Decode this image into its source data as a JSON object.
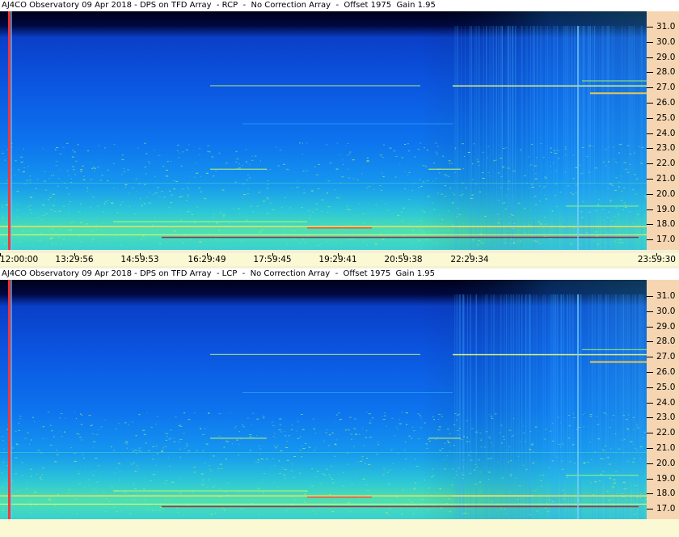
{
  "panels": [
    {
      "title": "AJ4CO Observatory 09 Apr 2018 - DPS on TFD Array  - RCP  -  No Correction Array  -  Offset 1975  Gain 1.95",
      "polarization": "RCP",
      "freq_labels": [
        "31.0",
        "30.0",
        "29.0",
        "28.0",
        "27.0",
        "26.0",
        "25.0",
        "24.0",
        "23.0",
        "22.0",
        "21.0",
        "20.0",
        "19.0",
        "18.0",
        "17.0"
      ],
      "time_labels": [
        "12:00:00",
        "13:29:56",
        "14:59:53",
        "16:29:49",
        "17:59:45",
        "19:29:41",
        "20:59:38",
        "22:29:34",
        "23:59:30"
      ]
    },
    {
      "title": "AJ4CO Observatory 09 Apr 2018 - DPS on TFD Array  - LCP  -  No Correction Array  -  Offset 1975  Gain 1.95",
      "polarization": "LCP",
      "freq_labels": [
        "31.0",
        "30.0",
        "29.0",
        "28.0",
        "27.0",
        "26.0",
        "25.0",
        "24.0",
        "23.0",
        "22.0",
        "21.0",
        "20.0",
        "19.0",
        "18.0",
        "17.0"
      ],
      "time_labels": []
    }
  ],
  "colors": {
    "background_top": "#00003a",
    "background_mid": "#0a4fd6",
    "background_low": "#2fd0c8",
    "freq_axis_bg": "#f6d6b2",
    "time_axis_bg": "#fbf8d4"
  }
}
